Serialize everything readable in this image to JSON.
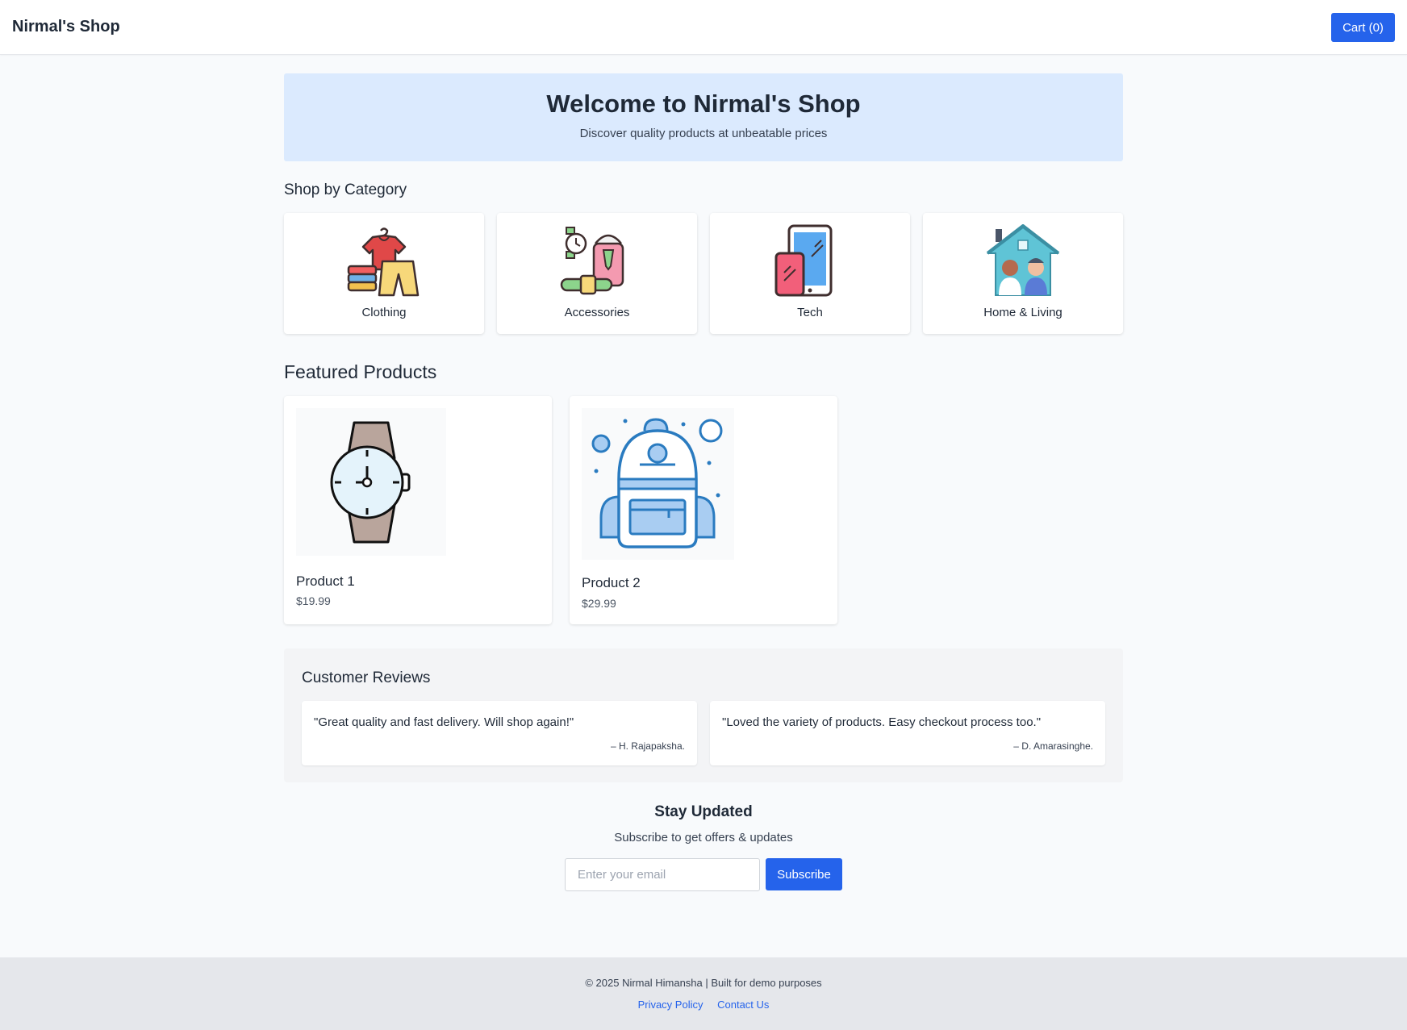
{
  "header": {
    "brand": "Nirmal's Shop",
    "cart_label": "Cart (0)"
  },
  "hero": {
    "title": "Welcome to Nirmal's Shop",
    "subtitle": "Discover quality products at unbeatable prices"
  },
  "categories": {
    "heading": "Shop by Category",
    "items": [
      {
        "label": "Clothing",
        "icon": "clothing-icon"
      },
      {
        "label": "Accessories",
        "icon": "accessories-icon"
      },
      {
        "label": "Tech",
        "icon": "tech-icon"
      },
      {
        "label": "Home & Living",
        "icon": "home-living-icon"
      }
    ]
  },
  "featured": {
    "heading": "Featured Products",
    "products": [
      {
        "name": "Product 1",
        "price": "$19.99",
        "icon": "watch-icon"
      },
      {
        "name": "Product 2",
        "price": "$29.99",
        "icon": "backpack-icon"
      }
    ]
  },
  "reviews": {
    "heading": "Customer Reviews",
    "items": [
      {
        "text": "\"Great quality and fast delivery. Will shop again!\"",
        "author": "– H. Rajapaksha."
      },
      {
        "text": "\"Loved the variety of products. Easy checkout process too.\"",
        "author": "– D. Amarasinghe."
      }
    ]
  },
  "newsletter": {
    "title": "Stay Updated",
    "subtitle": "Subscribe to get offers & updates",
    "placeholder": "Enter your email",
    "button_label": "Subscribe"
  },
  "footer": {
    "copyright": "© 2025 Nirmal Himansha | Built for demo purposes",
    "links": [
      "Privacy Policy",
      "Contact Us"
    ]
  },
  "colors": {
    "primary": "#2563eb",
    "hero_bg": "#dbeafe",
    "page_bg": "#f8fafc",
    "footer_bg": "#e5e7eb"
  }
}
